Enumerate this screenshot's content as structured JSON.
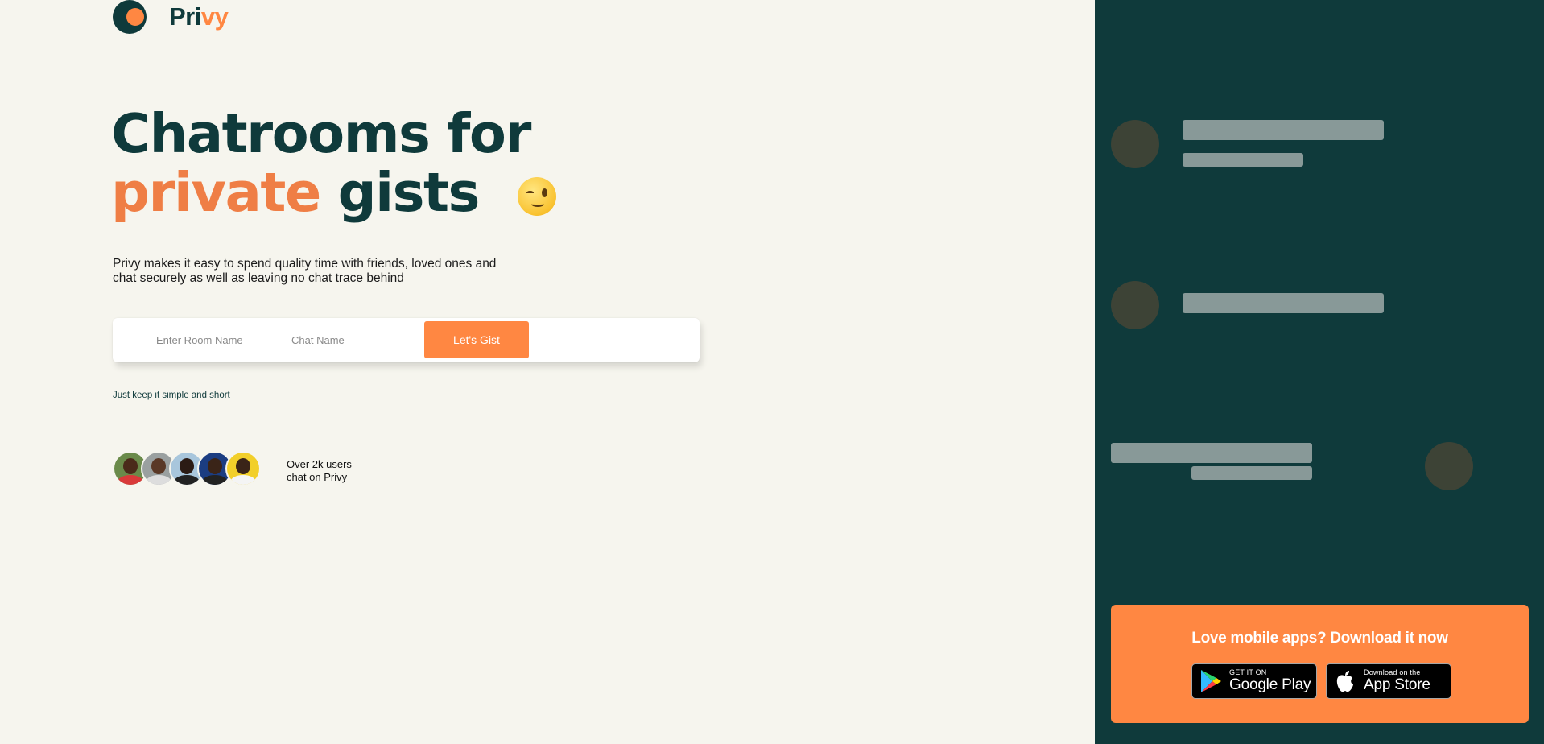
{
  "brand": {
    "text_main": "Pri",
    "text_accent": "vy"
  },
  "hero": {
    "line1": "Chatrooms for",
    "line2_accent": "private",
    "line2_rest": "gists",
    "description": "Privy makes it easy to spend quality time with friends, loved ones and chat securely as well as leaving no chat trace behind"
  },
  "form": {
    "room_placeholder": "Enter Room Name",
    "chat_placeholder": "Chat Name",
    "submit_label": "Let's Gist",
    "hint": "Just keep it simple and short"
  },
  "users": {
    "line1": "Over 2k users",
    "line2": "chat on Privy",
    "avatars": [
      "avatar-1",
      "avatar-2",
      "avatar-3",
      "avatar-4",
      "avatar-5"
    ]
  },
  "download": {
    "title": "Love mobile apps? Download it now",
    "google_small": "GET IT ON",
    "google_big": "Google Play",
    "apple_small": "Download on the",
    "apple_big": "App Store"
  },
  "colors": {
    "brand_dark": "#0f3a3b",
    "accent": "#ff8742",
    "background": "#f6f5ee"
  },
  "icons": [
    "logo-icon",
    "wink-emoji-icon",
    "google-play-icon",
    "apple-icon"
  ]
}
